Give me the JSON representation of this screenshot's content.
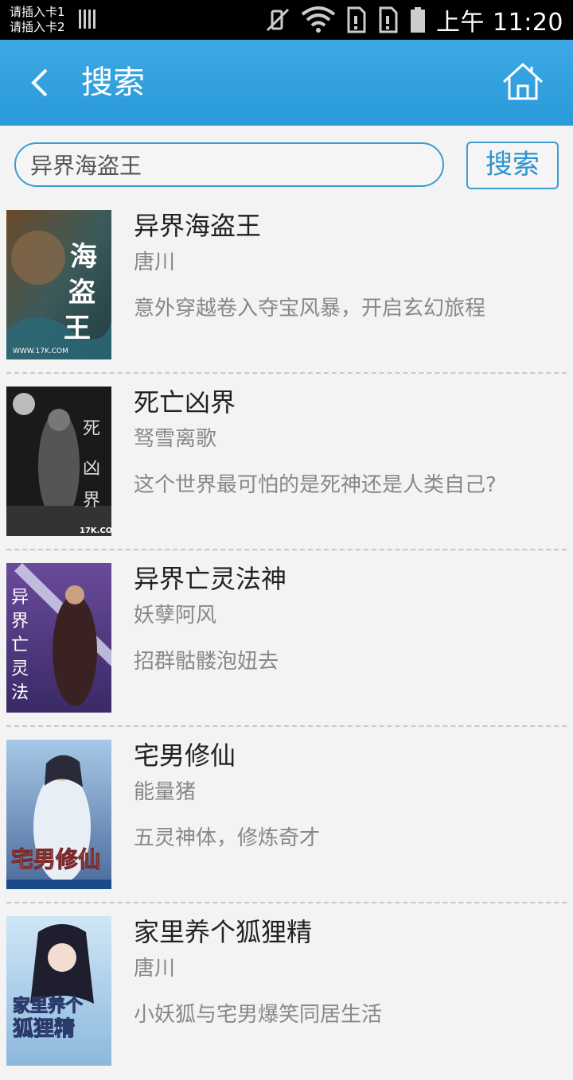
{
  "status_bar": {
    "sim1": "请插入卡1",
    "sim2": "请插入卡2",
    "time_prefix": "上午",
    "time": "11:20"
  },
  "header": {
    "title": "搜索",
    "back_icon": "chevron-left-icon",
    "home_icon": "home-icon"
  },
  "search": {
    "value": "异界海盗王",
    "button_label": "搜索"
  },
  "colors": {
    "accent": "#2f9ad9",
    "border": "#3a9ed2"
  },
  "books": [
    {
      "title": "异界海盗王",
      "author": "唐川",
      "desc": "意外穿越卷入夺宝风暴，开启玄幻旅程"
    },
    {
      "title": "死亡凶界",
      "author": "驽雪离歌",
      "desc": "这个世界最可怕的是死神还是人类自己?"
    },
    {
      "title": "异界亡灵法神",
      "author": "妖孽阿风",
      "desc": "招群骷髅泡妞去"
    },
    {
      "title": "宅男修仙",
      "author": "能量猪",
      "desc": "五灵神体，修炼奇才"
    },
    {
      "title": "家里养个狐狸精",
      "author": "唐川",
      "desc": "小妖狐与宅男爆笑同居生活"
    }
  ]
}
